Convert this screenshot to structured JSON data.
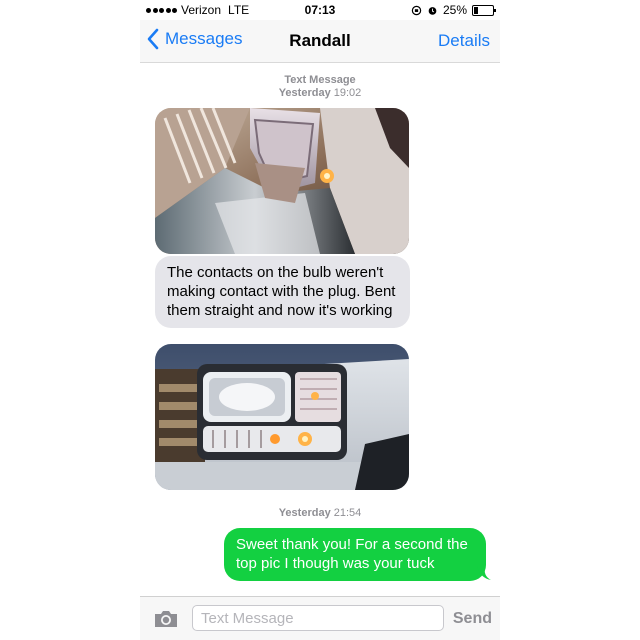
{
  "status_bar": {
    "carrier": "Verizon",
    "network": "LTE",
    "time": "07:13",
    "battery": "25%",
    "battery_level": 0.25
  },
  "nav": {
    "back_label": "Messages",
    "title": "Randall",
    "details_label": "Details"
  },
  "conversation": {
    "header_type": "Text Message",
    "first_timestamp_day": "Yesterday",
    "first_timestamp_time": "19:02",
    "incoming_text": "The contacts on the bulb weren't making contact with the plug. Bent them straight and now it's working",
    "second_timestamp_day": "Yesterday",
    "second_timestamp_time": "21:54",
    "outgoing_text": "Sweet thank you! For a second the top pic I though was your tuck"
  },
  "input_bar": {
    "placeholder": "Text Message",
    "send_label": "Send"
  },
  "colors": {
    "accent": "#1a7cf5",
    "incoming_bubble": "#e5e5ea",
    "outgoing_bubble": "#13d041"
  }
}
